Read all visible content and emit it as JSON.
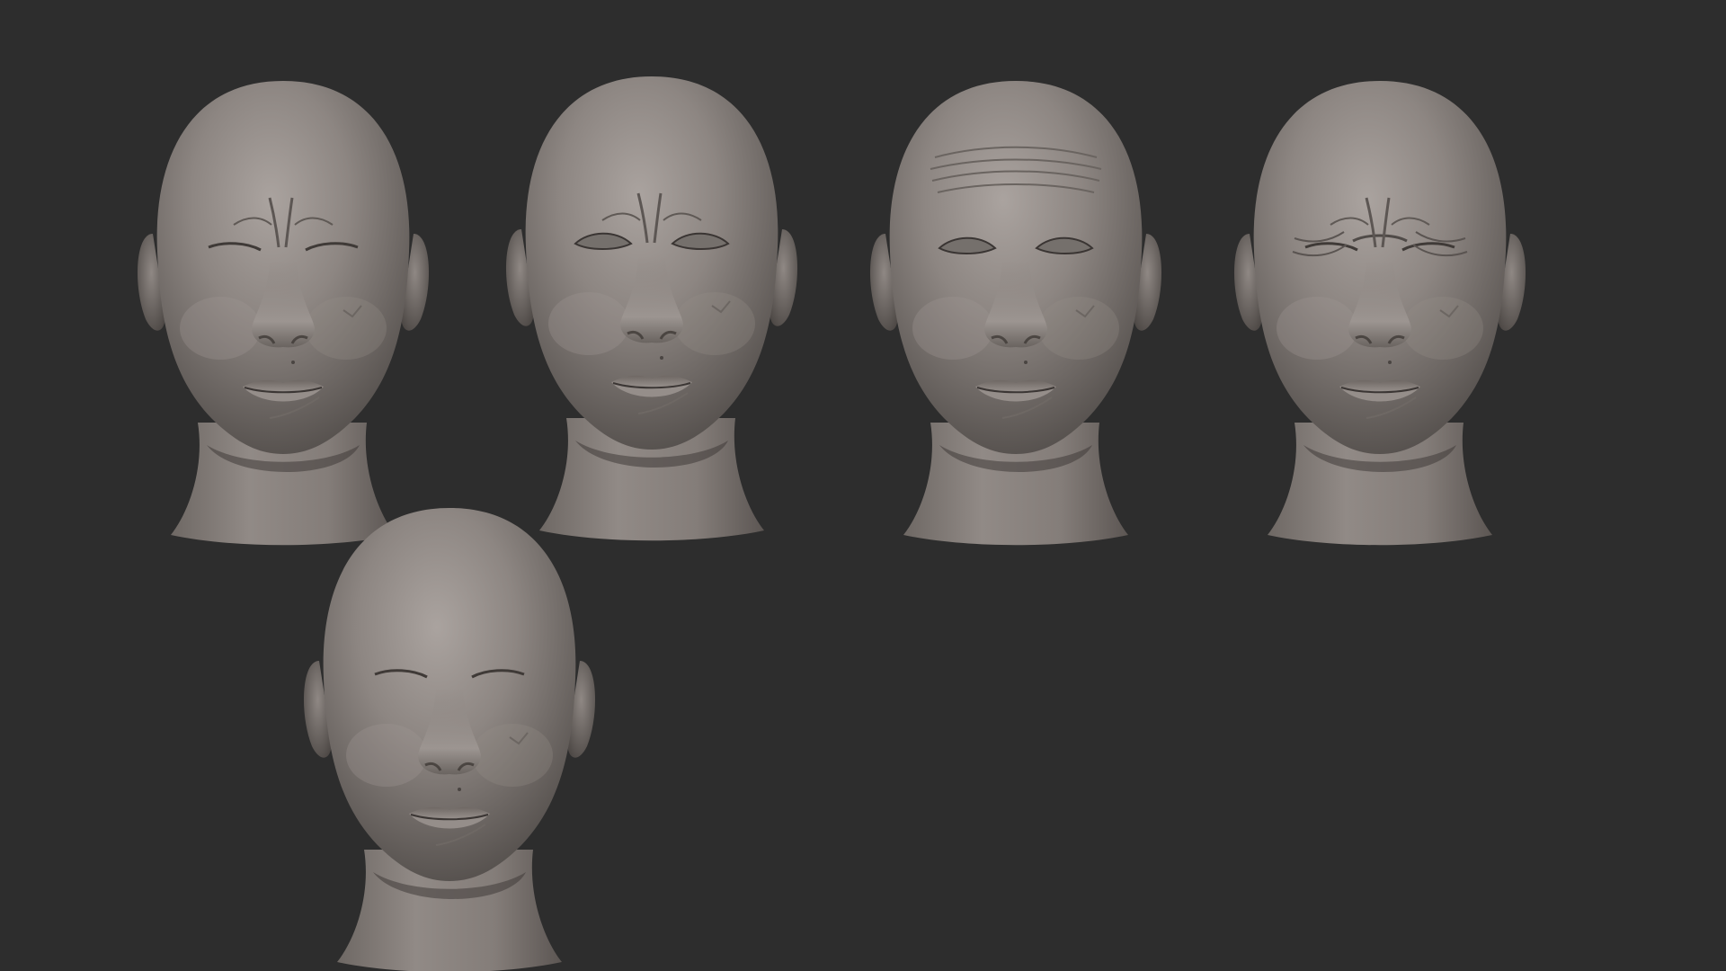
{
  "colors": {
    "background": "#2d2d2d",
    "clay": "#8a837f",
    "clay_light": "#a59e9a",
    "clay_shadow": "#4f4946",
    "lip": "#7a726e"
  },
  "heads": [
    {
      "expression": "frown-closed-eyes"
    },
    {
      "expression": "frown-open-eyes"
    },
    {
      "expression": "raised-brows-open-eyes"
    },
    {
      "expression": "squint-grimace"
    },
    {
      "expression": "neutral-closed-eyes"
    }
  ]
}
